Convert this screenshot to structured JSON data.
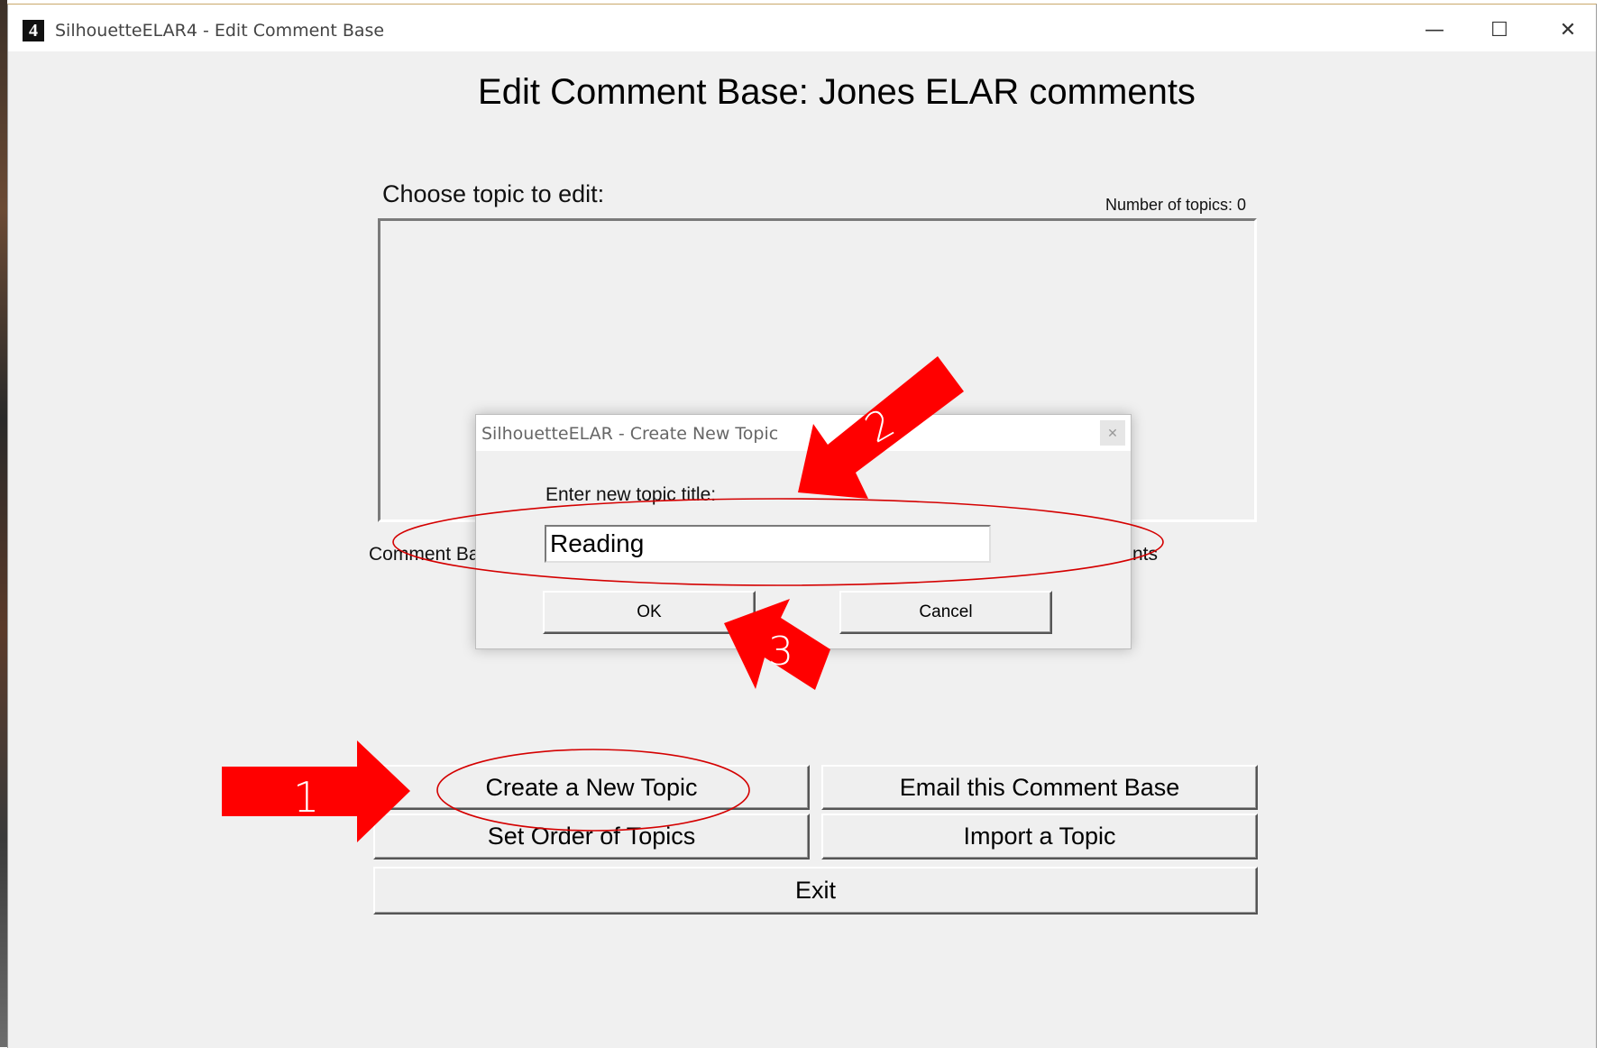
{
  "window": {
    "title": "SilhouetteELAR4 - Edit Comment Base",
    "icon": "4"
  },
  "window_controls": {
    "minimize": "—",
    "maximize": "☐",
    "close": "✕"
  },
  "page": {
    "title": "Edit Comment Base: Jones ELAR comments",
    "choose_label": "Choose topic to edit:",
    "topic_count": "Number of topics: 0",
    "comment_base_left": "Comment Ba",
    "comment_base_right": "nts"
  },
  "buttons": {
    "create": "Create a New Topic",
    "email": "Email this Comment Base",
    "order": "Set Order of Topics",
    "import": "Import a Topic",
    "exit": "Exit"
  },
  "dialog": {
    "title": "SilhouetteELAR - Create New Topic",
    "close": "✕",
    "label": "Enter new topic title:",
    "input_value": "Reading",
    "ok": "OK",
    "cancel": "Cancel"
  },
  "annotations": {
    "step1": "1",
    "step2": "2",
    "step3": "3",
    "arrow_color": "#ff0000"
  }
}
